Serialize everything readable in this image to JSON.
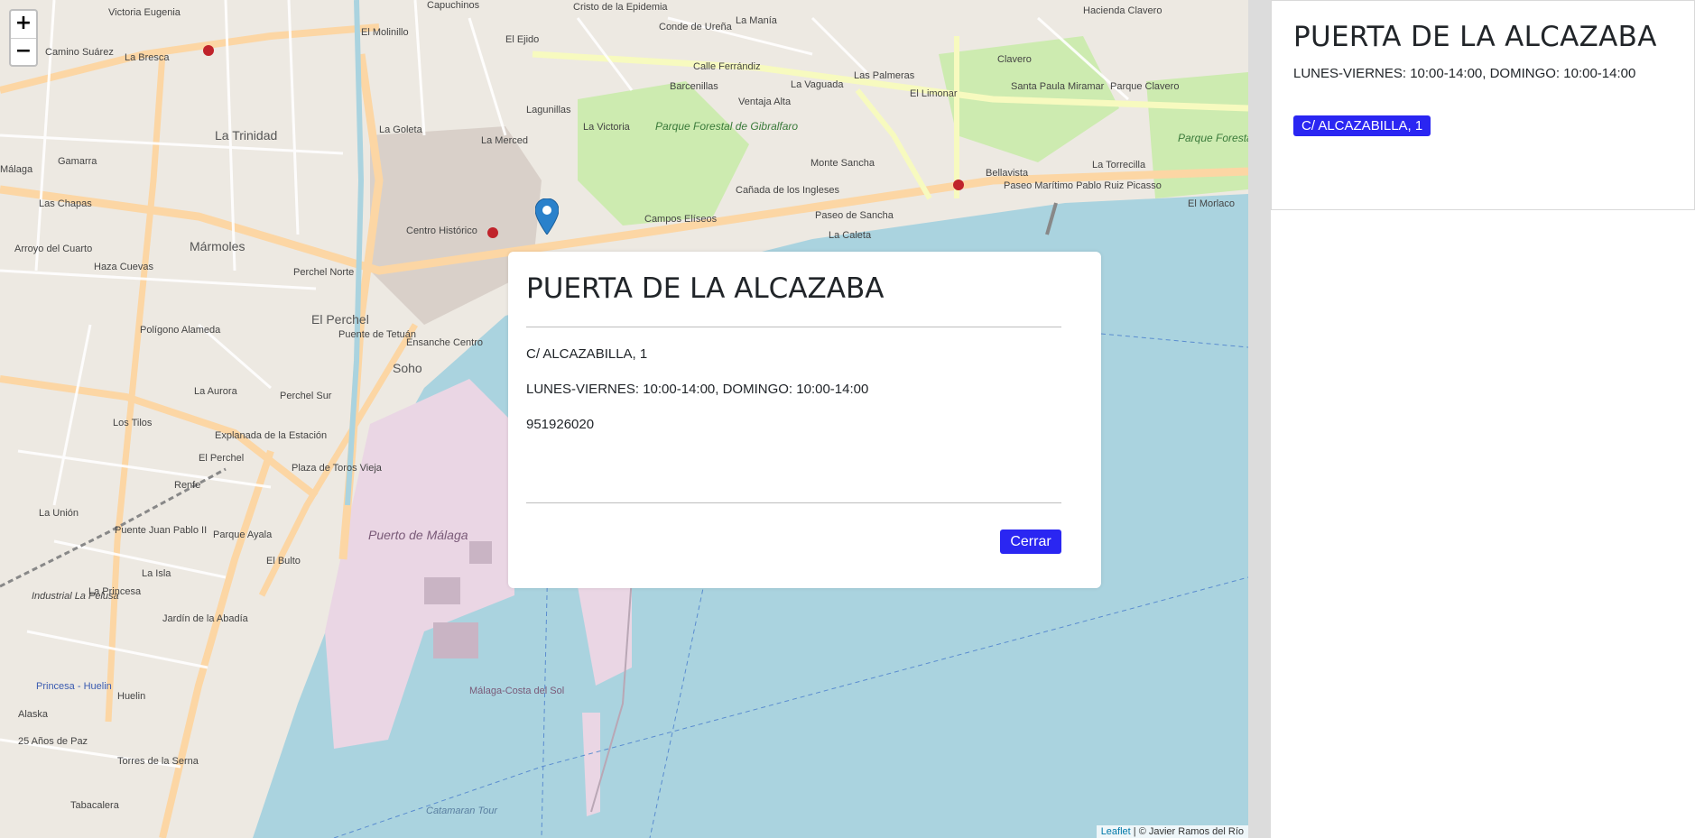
{
  "map": {
    "zoom_in": "+",
    "zoom_out": "−",
    "attribution_link": "Leaflet",
    "attribution_text": " | © Javier Ramos del Río",
    "labels": {
      "victoria_eugenia": "Victoria Eugenia",
      "capuchinos": "Capuchinos",
      "cristo": "Cristo de la Epidemia",
      "conde_urena": "Conde de Ureña",
      "la_mania": "La Manía",
      "hacienda_clavero": "Hacienda Clavero",
      "el_molinillo": "El Molinillo",
      "el_ejido": "El Ejido",
      "camino_suarez": "Camino Suárez",
      "la_bresca": "La Bresca",
      "calle_ferrandiz": "Calle Ferrándiz",
      "barcenillas": "Barcenillas",
      "la_vaguada": "La Vaguada",
      "las_palmeras": "Las Palmeras",
      "el_limonar": "El Limonar",
      "clavero": "Clavero",
      "santa_paula": "Santa Paula Miramar",
      "parque_clavero": "Parque Clavero",
      "la_trinidad": "La Trinidad",
      "la_goleta": "La Goleta",
      "lagunillas": "Lagunillas",
      "la_victoria": "La Victoria",
      "ventaja_alta": "Ventaja Alta",
      "parque_gibralfaro": "Parque Forestal de Gibralfaro",
      "monte_sancha": "Monte Sancha",
      "la_torrecilla": "La Torrecilla",
      "parque_morlaco": "Parque Forestal de El Morlaco",
      "la_merced": "La Merced",
      "bellavista": "Bellavista",
      "paseo_maritimo": "Paseo Marítimo Pablo Ruiz Picasso",
      "el_morlaco": "El Morlaco",
      "las_chapas": "Las Chapas",
      "gamarra": "Gamarra",
      "canada_ingleses": "Cañada de los Ingleses",
      "campos_eliseos": "Campos Elíseos",
      "paseo_sancha": "Paseo de Sancha",
      "la_caleta": "La Caleta",
      "centro_historico": "Centro Histórico",
      "marmoles": "Mármoles",
      "arroyo_cuarto": "Arroyo del Cuarto",
      "haza_cuevas": "Haza Cuevas",
      "perchel_norte": "Perchel Norte",
      "el_perchel": "El Perchel",
      "poligono_alameda": "Polígono Alameda",
      "puente_tetuan": "Puente de Tetuán",
      "ensanche_centro": "Ensanche Centro",
      "soho": "Soho",
      "la_aurora": "La Aurora",
      "perchel_sur": "Perchel Sur",
      "los_tilos": "Los Tilos",
      "explanada": "Explanada de la Estación",
      "el_perchel_station": "El Perchel",
      "plaza_toros": "Plaza de Toros Vieja",
      "renfe": "Renfe",
      "la_union": "La Unión",
      "puente_juan_pablo": "Puente Juan Pablo II",
      "parque_ayala": "Parque Ayala",
      "el_bulto": "El Bulto",
      "puerto_malaga": "Puerto de Málaga",
      "la_isla": "La Isla",
      "la_princesa": "La Princesa",
      "industrial_pelusa": "Industrial La Pelusa",
      "jardin_abadia": "Jardín de la Abadía",
      "princesa_huelin": "Princesa - Huelin",
      "huelin": "Huelin",
      "alaska": "Alaska",
      "25_anos": "25 Años de Paz",
      "torres_serna": "Torres de la Serna",
      "tabacalera": "Tabacalera",
      "catamaran": "Catamaran Tour",
      "malaga_costa": "Málaga-Costa del Sol",
      "malaga": "Málaga"
    }
  },
  "panel": {
    "title": "PUERTA DE LA ALCAZABA",
    "hours": "LUNES-VIERNES: 10:00-14:00, DOMINGO: 10:00-14:00",
    "address_badge": "C/ ALCAZABILLA, 1"
  },
  "modal": {
    "title": "PUERTA DE LA ALCAZABA",
    "address": "C/ ALCAZABILLA, 1",
    "hours": "LUNES-VIERNES: 10:00-14:00, DOMINGO: 10:00-14:00",
    "phone": "951926020",
    "close_label": "Cerrar"
  },
  "colors": {
    "accent": "#2a26f2",
    "sea": "#aad3df",
    "park": "#cdebb0",
    "port": "#ead6e4",
    "road": "#fcd6a4",
    "marker": "#2a81cb"
  }
}
